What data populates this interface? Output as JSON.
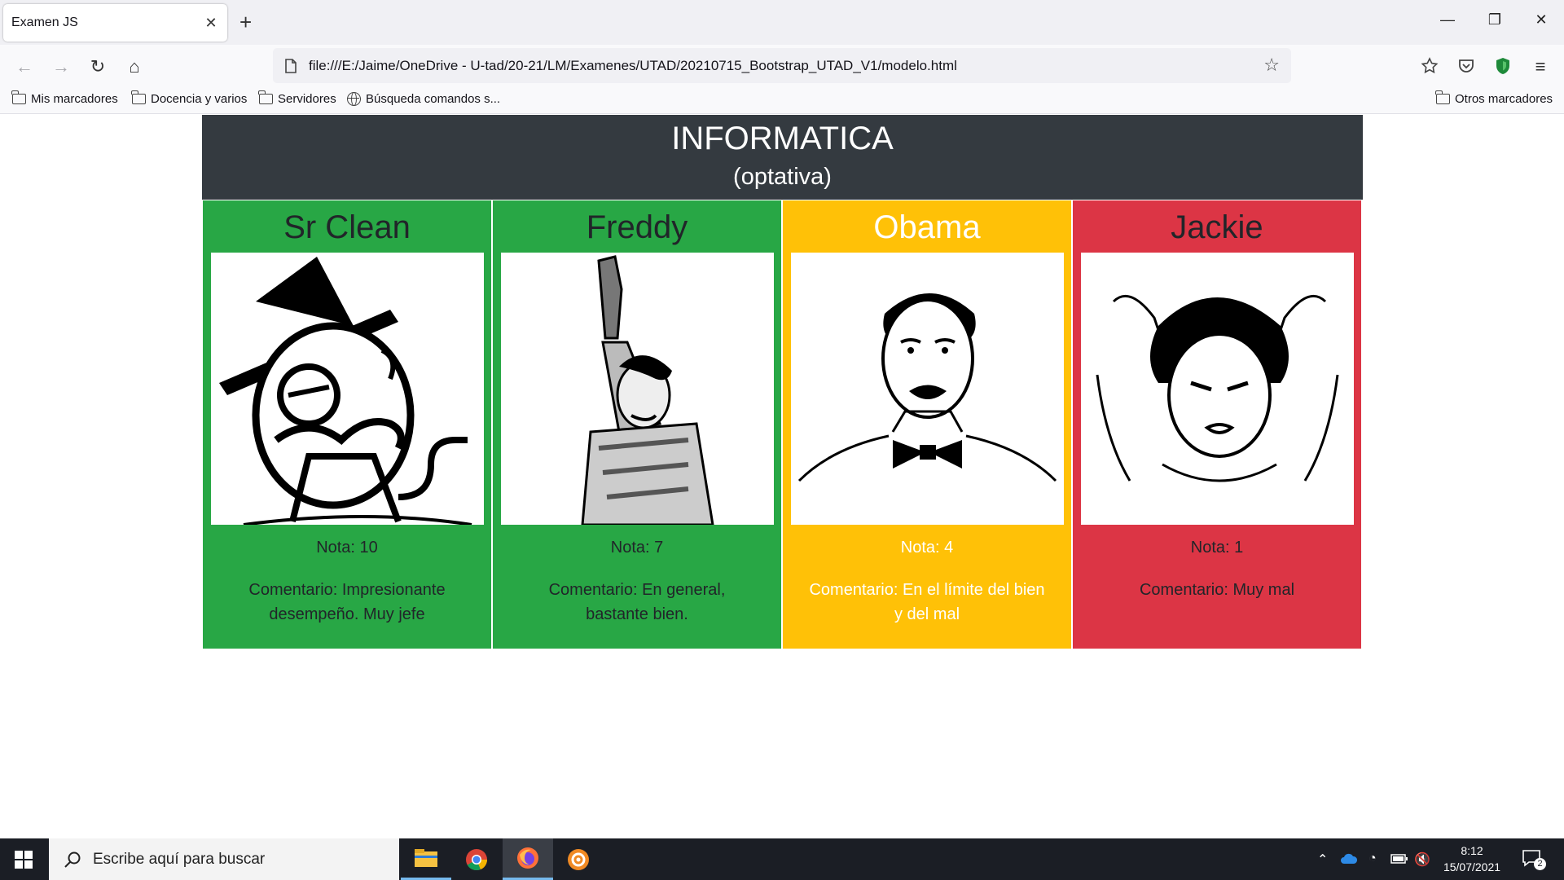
{
  "browser": {
    "tab_title": "Examen JS",
    "url": "file:///E:/Jaime/OneDrive - U-tad/20-21/LM/Examenes/UTAD/20210715_Bootstrap_UTAD_V1/modelo.html",
    "bookmarks": [
      "Mis marcadores",
      "Docencia y varios",
      "Servidores",
      "Búsqueda comandos s..."
    ],
    "other_bookmarks": "Otros marcadores"
  },
  "page": {
    "title": "INFORMATICA",
    "subtitle": "(optativa)",
    "cards": [
      {
        "name": "Sr Clean",
        "nota": "Nota: 10",
        "comentario": "Comentario: Impresionante desempeño. Muy jefe",
        "bg": "#28a745",
        "color": "#212529"
      },
      {
        "name": "Freddy",
        "nota": "Nota: 7",
        "comentario": "Comentario: En general, bastante bien.",
        "bg": "#28a745",
        "color": "#212529"
      },
      {
        "name": "Obama",
        "nota": "Nota: 4",
        "comentario": "Comentario: En el límite del bien y del mal",
        "bg": "#ffc107",
        "color": "#ffffff"
      },
      {
        "name": "Jackie",
        "nota": "Nota: 1",
        "comentario": "Comentario: Muy mal",
        "bg": "#dc3545",
        "color": "#212529"
      }
    ]
  },
  "taskbar": {
    "search_placeholder": "Escribe aquí para buscar",
    "time": "8:12",
    "date": "15/07/2021",
    "notifications": "2"
  },
  "colors": {
    "header_bg": "#343a40"
  }
}
